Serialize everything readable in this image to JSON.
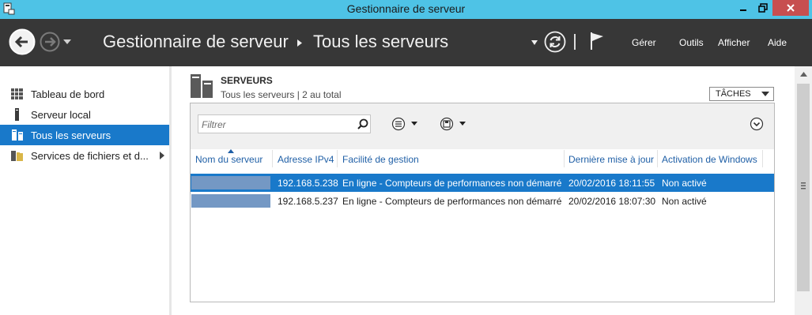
{
  "window": {
    "title": "Gestionnaire de serveur"
  },
  "header": {
    "breadcrumb": [
      "Gestionnaire de serveur",
      "Tous les serveurs"
    ],
    "menu": [
      "Gérer",
      "Outils",
      "Afficher",
      "Aide"
    ]
  },
  "sidebar": {
    "items": [
      {
        "label": "Tableau de bord",
        "icon": "dashboard-icon"
      },
      {
        "label": "Serveur local",
        "icon": "server-icon"
      },
      {
        "label": "Tous les serveurs",
        "icon": "servers-icon",
        "selected": true
      },
      {
        "label": "Services de fichiers et d...",
        "icon": "file-services-icon"
      }
    ]
  },
  "section": {
    "title": "SERVEURS",
    "subtitle": "Tous les serveurs | 2 au total",
    "tasks_label": "TÂCHES"
  },
  "filter": {
    "placeholder": "Filtrer"
  },
  "table": {
    "columns": [
      "Nom du serveur",
      "Adresse IPv4",
      "Facilité de gestion",
      "Dernière mise à jour",
      "Activation de Windows"
    ],
    "rows": [
      {
        "ip": "192.168.5.238",
        "manage": "En ligne - Compteurs de performances non démarré",
        "updated": "20/02/2016 18:11:55",
        "activation": "Non activé",
        "selected": true
      },
      {
        "ip": "192.168.5.237",
        "manage": "En ligne - Compteurs de performances non démarré",
        "updated": "20/02/2016 18:07:30",
        "activation": "Non activé",
        "selected": false
      }
    ]
  },
  "colors": {
    "titlebar": "#4ec3e6",
    "header": "#373737",
    "selection": "#1979ca",
    "link": "#1f5fa6",
    "close": "#c74f50"
  }
}
